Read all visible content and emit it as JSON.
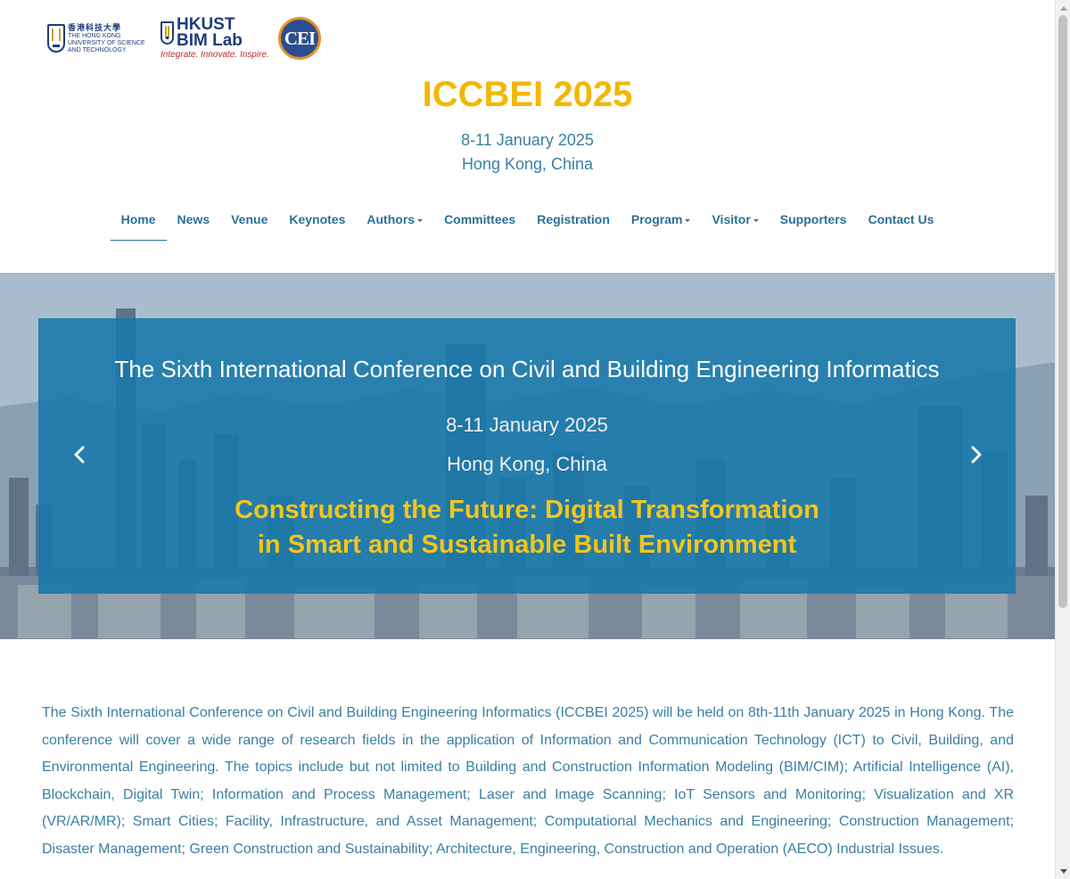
{
  "header": {
    "logos": {
      "hkust_cn": "香港科技大學",
      "hkust_en": [
        "THE HONG KONG",
        "UNIVERSITY OF SCIENCE",
        "AND TECHNOLOGY"
      ],
      "bim_line1": "HKUST",
      "bim_line2": "BIM Lab",
      "bim_tagline": "Integrate. Innovate. Inspire.",
      "cei": "CEI"
    },
    "title": "ICCBEI 2025",
    "date": "8-11 January 2025",
    "location": "Hong Kong, China"
  },
  "nav": {
    "items": [
      {
        "label": "Home",
        "active": true,
        "dropdown": false
      },
      {
        "label": "News",
        "active": false,
        "dropdown": false
      },
      {
        "label": "Venue",
        "active": false,
        "dropdown": false
      },
      {
        "label": "Keynotes",
        "active": false,
        "dropdown": false
      },
      {
        "label": "Authors",
        "active": false,
        "dropdown": true
      },
      {
        "label": "Committees",
        "active": false,
        "dropdown": false
      },
      {
        "label": "Registration",
        "active": false,
        "dropdown": false
      },
      {
        "label": "Program",
        "active": false,
        "dropdown": true
      },
      {
        "label": "Visitor",
        "active": false,
        "dropdown": true
      },
      {
        "label": "Supporters",
        "active": false,
        "dropdown": false
      },
      {
        "label": "Contact Us",
        "active": false,
        "dropdown": false
      }
    ]
  },
  "hero": {
    "title": "The Sixth International Conference on Civil and Building Engineering Informatics",
    "date": "8-11 January 2025",
    "location": "Hong Kong, China",
    "theme_line1": "Constructing the Future: Digital Transformation",
    "theme_line2": "in Smart and Sustainable Built Environment",
    "prev_icon": "chevron-left-icon",
    "next_icon": "chevron-right-icon"
  },
  "intro": {
    "text": "The Sixth International Conference on Civil and Building Engineering Informatics (ICCBEI 2025) will be held on 8th-11th January 2025 in Hong Kong. The conference will cover a wide range of research fields in the application of Information and Communication Technology (ICT) to Civil, Building, and Environmental Engineering. The topics include but not limited to Building and Construction Information Modeling (BIM/CIM); Artificial Intelligence (AI), Blockchain, Digital Twin; Information and Process Management; Laser and Image Scanning; IoT Sensors and Monitoring; Visualization and XR (VR/AR/MR); Smart Cities; Facility, Infrastructure, and Asset Management; Computational Mechanics and Engineering; Construction Management; Disaster Management; Green Construction and Sustainability; Architecture, Engineering, Construction and Operation (AECO) Industrial Issues."
  },
  "colors": {
    "title_yellow": "#f2b705",
    "link_blue": "#2b6f97",
    "text_blue": "#3a7fa2",
    "hero_overlay": "#1778aa",
    "theme_yellow": "#f5c518"
  }
}
